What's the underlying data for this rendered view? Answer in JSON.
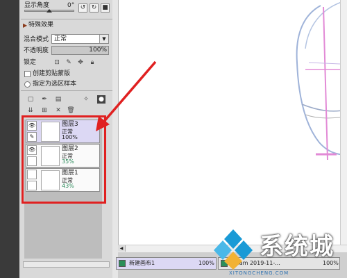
{
  "top": {
    "angle_label": "显示角度",
    "angle_value": "0°"
  },
  "special": {
    "header": "特殊效果",
    "blend_label": "混合模式",
    "blend_value": "正常",
    "opacity_label": "不透明度",
    "opacity_value": "100%",
    "opacity_fill": 1.0,
    "lock_label": "锁定",
    "clip_label": "创建剪贴蒙版",
    "select_source_label": "指定为选区样本"
  },
  "layers": [
    {
      "name": "图层3",
      "mode": "正常",
      "opacity": "100%",
      "selected": true,
      "visible_icon": "eye-icon",
      "opacity_color": "#333333"
    },
    {
      "name": "图层2",
      "mode": "正常",
      "opacity": "35%",
      "selected": false,
      "visible_icon": "eye-icon",
      "opacity_color": "#2a8a5a"
    },
    {
      "name": "图层1",
      "mode": "正常",
      "opacity": "43%",
      "selected": false,
      "visible_icon": "",
      "opacity_color": "#2a8a5a"
    }
  ],
  "canvas_tabs": [
    {
      "label": "新建画布1",
      "zoom": "100%"
    },
    {
      "label": "dicam 2019-11-...",
      "zoom": "100%"
    }
  ],
  "watermark": {
    "text": "系统城",
    "url": "XITONGCHENG.COM"
  },
  "colors": {
    "annotation_red": "#e02020",
    "selection": "#dcd8f4",
    "brand_blue": "#1a9ad6"
  }
}
